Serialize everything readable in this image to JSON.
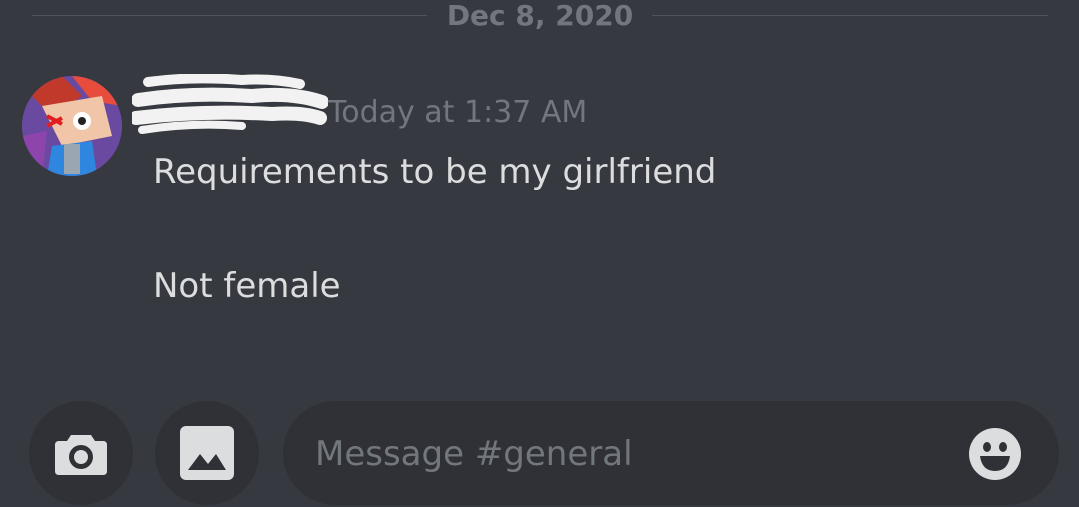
{
  "date_divider": {
    "text": "Dec 8, 2020"
  },
  "message": {
    "username": "[redacted]",
    "timestamp": "Today at 1:37 AM",
    "lines": [
      "Requirements to be my girlfriend",
      "Not female"
    ],
    "avatar_icon": "avatar-image"
  },
  "input_bar": {
    "camera_icon": "camera-icon",
    "gallery_icon": "image-gallery-icon",
    "placeholder": "Message #general",
    "value": "",
    "emoji_icon": "emoji-icon"
  },
  "colors": {
    "background": "#36393f",
    "input_background": "#2f3136",
    "text_normal": "#dcddde",
    "text_muted": "#72767d",
    "divider": "#4f545c"
  }
}
